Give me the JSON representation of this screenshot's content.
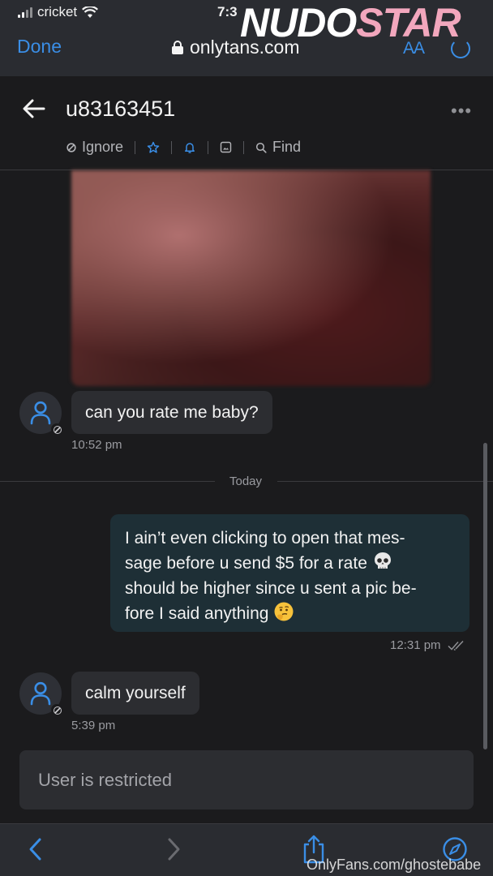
{
  "status_bar": {
    "carrier": "cricket",
    "time": "7:3"
  },
  "browser": {
    "done_label": "Done",
    "url": "onlytans.com",
    "text_size_label": "AA",
    "accent_color": "#3a8ee6"
  },
  "watermark": {
    "part1": "NUDO",
    "part2": "STAR",
    "credit": "OnlyFans.com/ghostebabe"
  },
  "chat_header": {
    "username": "u83163451",
    "more_label": "•••",
    "actions": {
      "ignore": "Ignore",
      "find": "Find"
    }
  },
  "messages": [
    {
      "direction": "incoming",
      "text": "can you rate me baby?",
      "time": "10:52 pm"
    },
    {
      "direction": "divider",
      "text": "Today"
    },
    {
      "direction": "outgoing",
      "text_lines": [
        "I ain’t even clicking to open that mes-",
        "sage before u send $5 for a rate",
        "should be higher since u sent a pic be-",
        "fore I said anything"
      ],
      "time": "12:31 pm"
    },
    {
      "direction": "incoming",
      "text": "calm yourself",
      "time": "5:39 pm"
    }
  ],
  "restricted_notice": "User is restricted",
  "icons": [
    "signal-icon",
    "wifi-icon",
    "lock-icon",
    "reload-icon",
    "back-arrow-icon",
    "more-icon",
    "ignore-icon",
    "star-icon",
    "bell-icon",
    "image-icon",
    "search-icon",
    "user-icon",
    "restricted-icon",
    "skull-emoji",
    "thinking-emoji",
    "double-check-icon",
    "chevron-left-icon",
    "chevron-right-icon",
    "share-icon",
    "compass-icon"
  ]
}
